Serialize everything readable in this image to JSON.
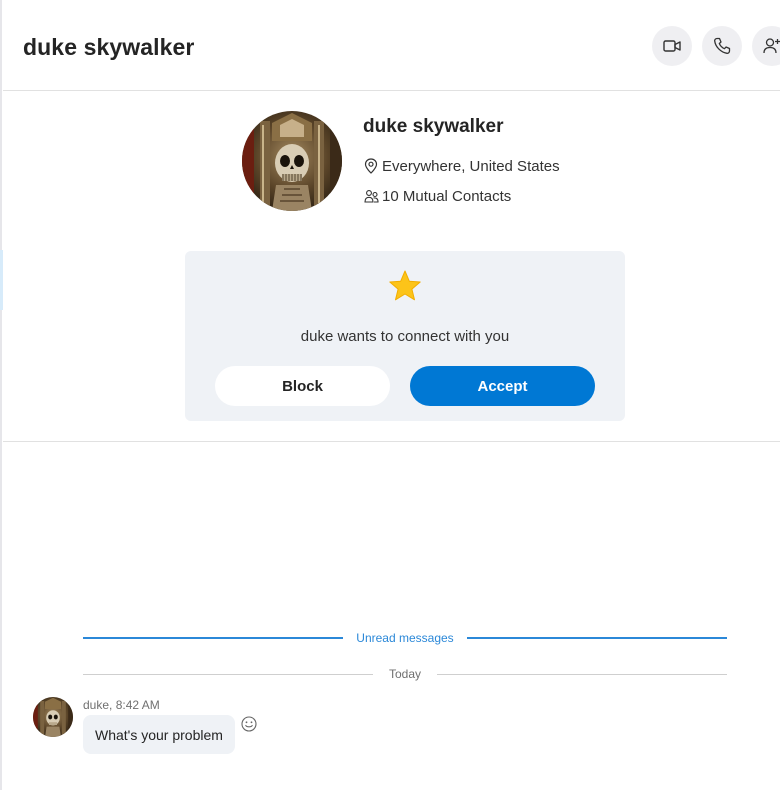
{
  "header": {
    "title": "duke skywalker",
    "actions": [
      {
        "name": "video-call",
        "icon": "video-camera-icon"
      },
      {
        "name": "audio-call",
        "icon": "phone-icon"
      },
      {
        "name": "add-people",
        "icon": "add-person-icon"
      }
    ]
  },
  "profile": {
    "name": "duke skywalker",
    "location": "Everywhere, United States",
    "mutual_contacts": "10 Mutual Contacts",
    "location_icon": "location-pin-icon",
    "contacts_icon": "people-icon"
  },
  "request": {
    "icon": "star-icon",
    "message": "duke wants to connect with you",
    "block_label": "Block",
    "accept_label": "Accept"
  },
  "dividers": {
    "unread_label": "Unread messages",
    "today_label": "Today"
  },
  "messages": [
    {
      "sender_time": "duke, 8:42 AM",
      "text": "What's your problem"
    }
  ],
  "colors": {
    "accent": "#0078d4",
    "unread_divider": "#2b88d8",
    "card_background": "#eff2f6",
    "star": "#fcc419"
  }
}
